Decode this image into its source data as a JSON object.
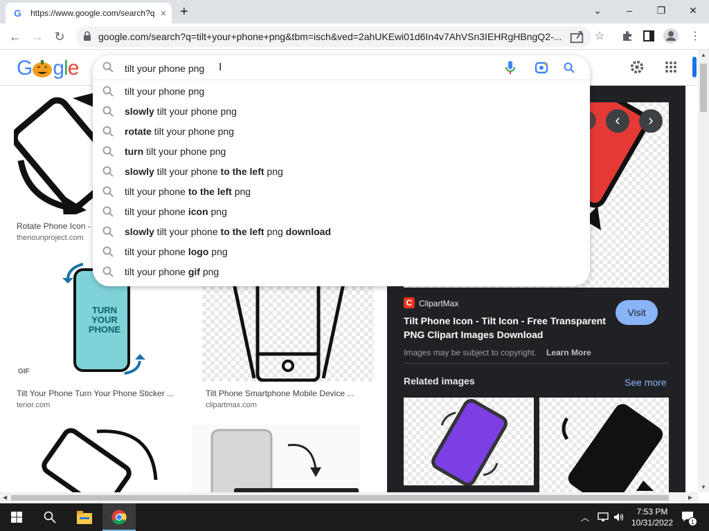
{
  "browser": {
    "tab_title": "https://www.google.com/search?q=tilt+your+phone+png",
    "tab_close": "×",
    "new_tab": "+",
    "url": "google.com/search?q=tilt+your+phone+png&tbm=isch&ved=2ahUKEwi01d6In4v7AhVSn3IEHRgHBngQ2-...",
    "win_minimize": "–",
    "win_restore": "❐",
    "win_close": "✕",
    "win_dropdown": "⌄"
  },
  "google": {
    "logo": "Google",
    "query": "tilt your phone png",
    "suggestions": [
      {
        "pre": "",
        "b1": "",
        "mid": "tilt your phone png",
        "b2": "",
        "post": "",
        "b3": ""
      },
      {
        "pre": "",
        "b1": "slowly",
        "mid": " tilt your phone png",
        "b2": "",
        "post": "",
        "b3": ""
      },
      {
        "pre": "",
        "b1": "rotate",
        "mid": " tilt your phone png",
        "b2": "",
        "post": "",
        "b3": ""
      },
      {
        "pre": "",
        "b1": "turn",
        "mid": " tilt your phone png",
        "b2": "",
        "post": "",
        "b3": ""
      },
      {
        "pre": "",
        "b1": "slowly",
        "mid": " tilt your phone ",
        "b2": "to the left",
        "post": " png",
        "b3": ""
      },
      {
        "pre": "",
        "b1": "",
        "mid": "tilt your phone ",
        "b2": "to the left",
        "post": " png",
        "b3": ""
      },
      {
        "pre": "",
        "b1": "",
        "mid": "tilt your phone ",
        "b2": "icon",
        "post": " png",
        "b3": ""
      },
      {
        "pre": "",
        "b1": "slowly",
        "mid": " tilt your phone ",
        "b2": "to the left",
        "post": " png ",
        "b3": "download"
      },
      {
        "pre": "",
        "b1": "",
        "mid": "tilt your phone ",
        "b2": "logo",
        "post": " png",
        "b3": ""
      },
      {
        "pre": "",
        "b1": "",
        "mid": "tilt your phone ",
        "b2": "gif",
        "post": " png",
        "b3": ""
      }
    ]
  },
  "results": [
    {
      "caption": "Rotate Phone Icon -",
      "source": "thenounproject.com"
    },
    {
      "caption": "Tilt Your Phone Turn Your Phone Sticker ...",
      "source": "tenor.com",
      "badge": "GIF",
      "art_text": "TURN YOUR PHONE"
    },
    {
      "caption": "Tilt Phone Smartphone Mobile Device ...",
      "source": "clipartmax.com"
    }
  ],
  "panel": {
    "source_name": "ClipartMax",
    "source_logo_letter": "C",
    "title": "Tilt Phone Icon - Tilt Icon - Free Transparent PNG Clipart Images Download",
    "visit": "Visit",
    "copyright": "Images may be subject to copyright.",
    "learn_more": "Learn More",
    "related": "Related images",
    "see_more": "See more",
    "prev": "‹",
    "next": "›"
  },
  "taskbar": {
    "time": "7:53 PM",
    "date": "10/31/2022",
    "notif_count": "1"
  },
  "colors": {
    "accent_blue": "#1a73e8",
    "panel_bg": "#202124",
    "visit_bg": "#8ab4f8",
    "see_more": "#8ab4f8",
    "clipartmax_red": "#e8321d"
  }
}
